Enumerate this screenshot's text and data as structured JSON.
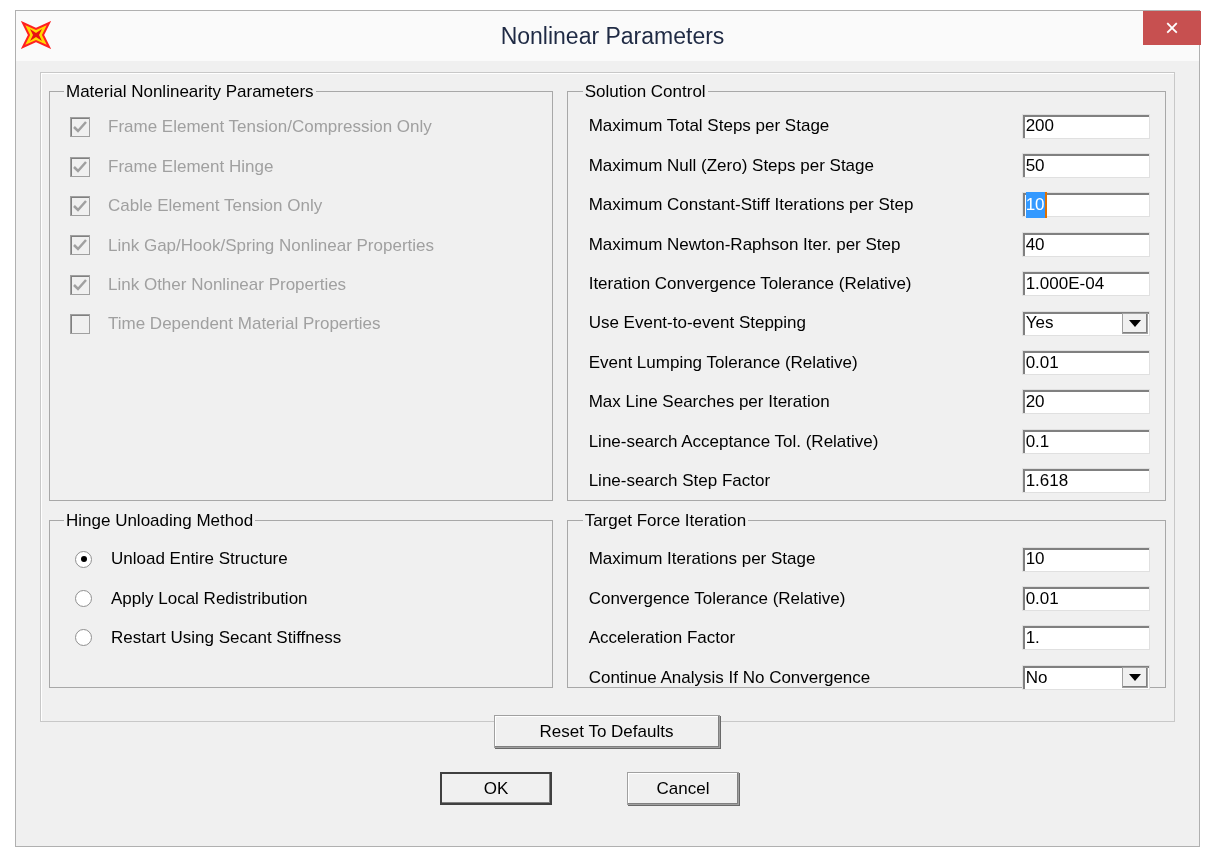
{
  "window": {
    "title": "Nonlinear Parameters",
    "close": "×"
  },
  "material": {
    "title": "Material Nonlinearity Parameters",
    "items": [
      {
        "label": "Frame Element Tension/Compression Only",
        "checked": true,
        "disabled": true
      },
      {
        "label": "Frame Element Hinge",
        "checked": true,
        "disabled": true
      },
      {
        "label": "Cable Element Tension Only",
        "checked": true,
        "disabled": true
      },
      {
        "label": "Link Gap/Hook/Spring Nonlinear Properties",
        "checked": true,
        "disabled": true
      },
      {
        "label": "Link Other Nonlinear Properties",
        "checked": true,
        "disabled": true
      },
      {
        "label": "Time Dependent Material Properties",
        "checked": false,
        "disabled": true
      }
    ]
  },
  "solution": {
    "title": "Solution Control",
    "rows": [
      {
        "label": "Maximum Total Steps per Stage",
        "kind": "field",
        "value": "200",
        "text_selected": false
      },
      {
        "label": "Maximum Null (Zero) Steps per Stage",
        "kind": "field",
        "value": "50",
        "text_selected": false
      },
      {
        "label": "Maximum Constant-Stiff Iterations per Step",
        "kind": "field",
        "value": "10",
        "text_selected": true
      },
      {
        "label": "Maximum Newton-Raphson Iter. per Step",
        "kind": "field",
        "value": "40",
        "text_selected": false
      },
      {
        "label": "Iteration Convergence Tolerance (Relative)",
        "kind": "field",
        "value": "1.000E-04",
        "text_selected": false
      },
      {
        "label": "Use Event-to-event Stepping",
        "kind": "dropdown",
        "value": "Yes"
      },
      {
        "label": "Event Lumping Tolerance (Relative)",
        "kind": "field",
        "value": "0.01",
        "text_selected": false
      },
      {
        "label": "Max Line Searches per Iteration",
        "kind": "field",
        "value": "20",
        "text_selected": false
      },
      {
        "label": "Line-search Acceptance Tol. (Relative)",
        "kind": "field",
        "value": "0.1",
        "text_selected": false
      },
      {
        "label": "Line-search Step Factor",
        "kind": "field",
        "value": "1.618",
        "text_selected": false
      }
    ]
  },
  "hinge": {
    "title": "Hinge Unloading Method",
    "options": [
      {
        "label": "Unload Entire Structure",
        "selected": true
      },
      {
        "label": "Apply Local Redistribution",
        "selected": false
      },
      {
        "label": "Restart Using Secant Stiffness",
        "selected": false
      }
    ]
  },
  "target": {
    "title": "Target Force Iteration",
    "rows": [
      {
        "label": "Maximum Iterations per Stage",
        "kind": "field",
        "value": "10",
        "text_selected": false
      },
      {
        "label": "Convergence Tolerance (Relative)",
        "kind": "field",
        "value": "0.01",
        "text_selected": false
      },
      {
        "label": "Acceleration Factor",
        "kind": "field",
        "value": "1.",
        "text_selected": false
      },
      {
        "label": "Continue Analysis If No Convergence",
        "kind": "dropdown",
        "value": "No"
      }
    ]
  },
  "buttons": {
    "reset": "Reset To Defaults",
    "ok": "OK",
    "cancel": "Cancel"
  }
}
